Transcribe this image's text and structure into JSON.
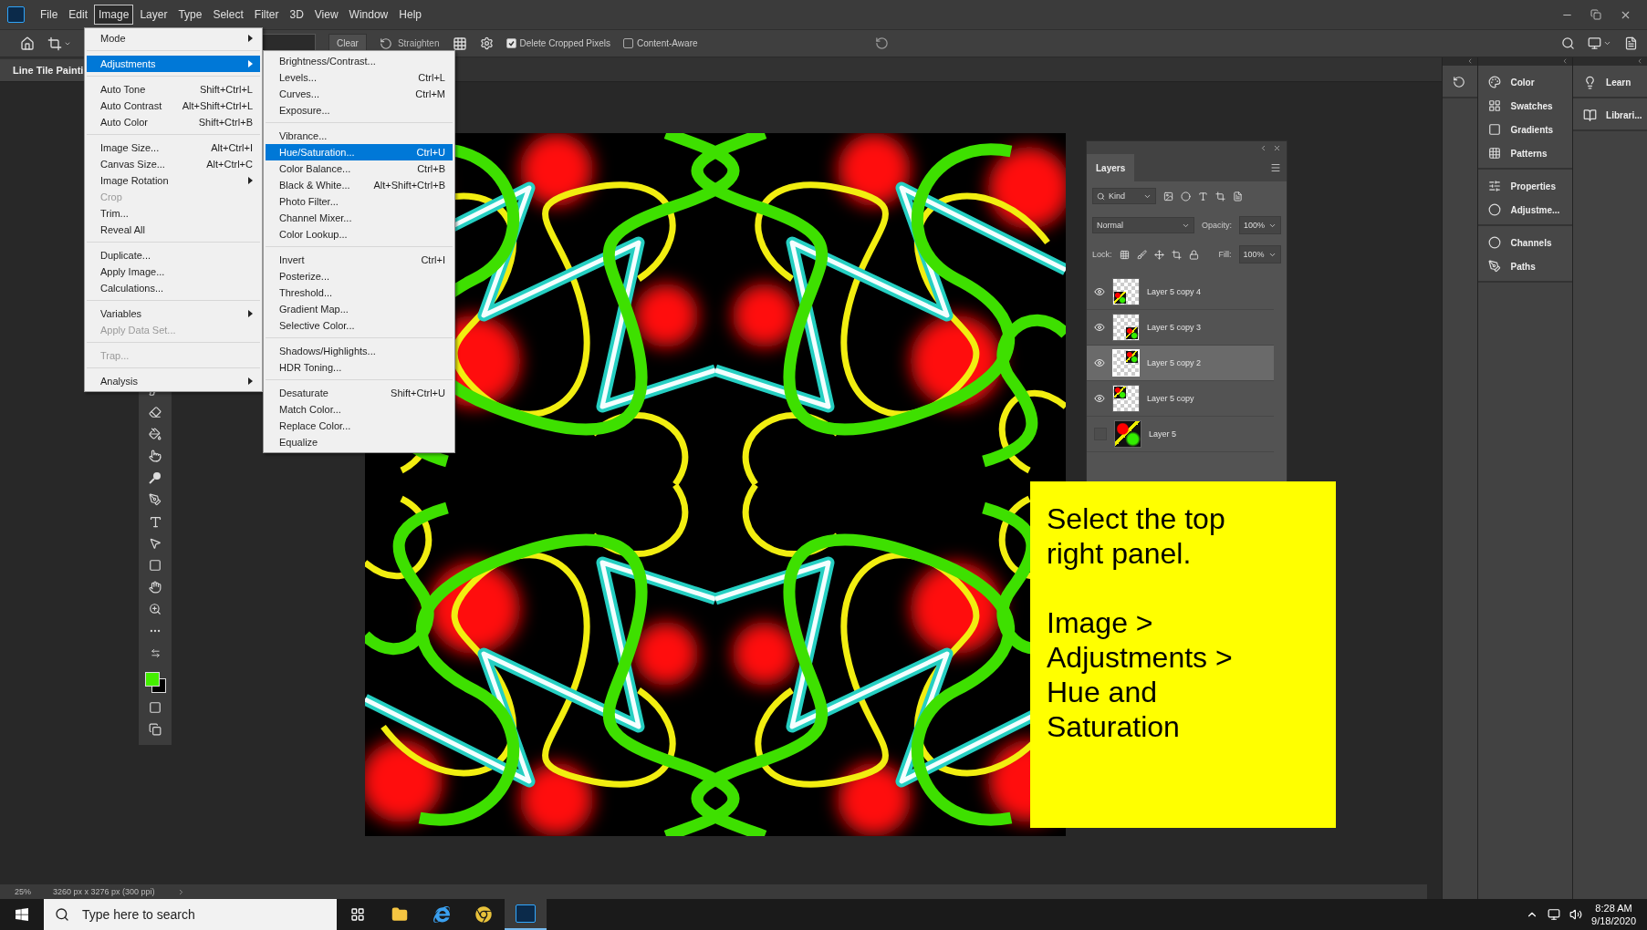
{
  "menu_bar": {
    "items": [
      {
        "label": "File",
        "selected": false
      },
      {
        "label": "Edit",
        "selected": false
      },
      {
        "label": "Image",
        "selected": true
      },
      {
        "label": "Layer",
        "selected": false
      },
      {
        "label": "Type",
        "selected": false
      },
      {
        "label": "Select",
        "selected": false
      },
      {
        "label": "Filter",
        "selected": false
      },
      {
        "label": "3D",
        "selected": false
      },
      {
        "label": "View",
        "selected": false
      },
      {
        "label": "Window",
        "selected": false
      },
      {
        "label": "Help",
        "selected": false
      }
    ]
  },
  "options_bar": {
    "clear_button": "Clear",
    "straighten_button": "Straighten",
    "delete_cropped_pixels": {
      "label": "Delete Cropped Pixels",
      "checked": true
    },
    "content_aware": {
      "label": "Content-Aware",
      "checked": false
    }
  },
  "document_tab": {
    "title": "Line Tile Painti"
  },
  "image_menu": {
    "groups": [
      [
        {
          "label": "Mode",
          "submenu": true,
          "disabled": false,
          "selected": false
        }
      ],
      [
        {
          "label": "Adjustments",
          "submenu": true,
          "disabled": false,
          "selected": true
        }
      ],
      [
        {
          "label": "Auto Tone",
          "shortcut": "Shift+Ctrl+L",
          "submenu": false,
          "disabled": false,
          "selected": false
        },
        {
          "label": "Auto Contrast",
          "shortcut": "Alt+Shift+Ctrl+L",
          "submenu": false,
          "disabled": false,
          "selected": false
        },
        {
          "label": "Auto Color",
          "shortcut": "Shift+Ctrl+B",
          "submenu": false,
          "disabled": false,
          "selected": false
        }
      ],
      [
        {
          "label": "Image Size...",
          "shortcut": "Alt+Ctrl+I",
          "submenu": false,
          "disabled": false,
          "selected": false
        },
        {
          "label": "Canvas Size...",
          "shortcut": "Alt+Ctrl+C",
          "submenu": false,
          "disabled": false,
          "selected": false
        },
        {
          "label": "Image Rotation",
          "submenu": true,
          "disabled": false,
          "selected": false
        },
        {
          "label": "Crop",
          "submenu": false,
          "disabled": true,
          "selected": false
        },
        {
          "label": "Trim...",
          "submenu": false,
          "disabled": false,
          "selected": false
        },
        {
          "label": "Reveal All",
          "submenu": false,
          "disabled": false,
          "selected": false
        }
      ],
      [
        {
          "label": "Duplicate...",
          "submenu": false,
          "disabled": false,
          "selected": false
        },
        {
          "label": "Apply Image...",
          "submenu": false,
          "disabled": false,
          "selected": false
        },
        {
          "label": "Calculations...",
          "submenu": false,
          "disabled": false,
          "selected": false
        }
      ],
      [
        {
          "label": "Variables",
          "submenu": true,
          "disabled": false,
          "selected": false
        },
        {
          "label": "Apply Data Set...",
          "submenu": false,
          "disabled": true,
          "selected": false
        }
      ],
      [
        {
          "label": "Trap...",
          "submenu": false,
          "disabled": true,
          "selected": false
        }
      ],
      [
        {
          "label": "Analysis",
          "submenu": true,
          "disabled": false,
          "selected": false
        }
      ]
    ]
  },
  "adjustments_menu": {
    "groups": [
      [
        {
          "label": "Brightness/Contrast...",
          "selected": false
        },
        {
          "label": "Levels...",
          "shortcut": "Ctrl+L",
          "selected": false
        },
        {
          "label": "Curves...",
          "shortcut": "Ctrl+M",
          "selected": false
        },
        {
          "label": "Exposure...",
          "selected": false
        }
      ],
      [
        {
          "label": "Vibrance...",
          "selected": false
        },
        {
          "label": "Hue/Saturation...",
          "shortcut": "Ctrl+U",
          "selected": true
        },
        {
          "label": "Color Balance...",
          "shortcut": "Ctrl+B",
          "selected": false
        },
        {
          "label": "Black & White...",
          "shortcut": "Alt+Shift+Ctrl+B",
          "selected": false
        },
        {
          "label": "Photo Filter...",
          "selected": false
        },
        {
          "label": "Channel Mixer...",
          "selected": false
        },
        {
          "label": "Color Lookup...",
          "selected": false
        }
      ],
      [
        {
          "label": "Invert",
          "shortcut": "Ctrl+I",
          "selected": false
        },
        {
          "label": "Posterize...",
          "selected": false
        },
        {
          "label": "Threshold...",
          "selected": false
        },
        {
          "label": "Gradient Map...",
          "selected": false
        },
        {
          "label": "Selective Color...",
          "selected": false
        }
      ],
      [
        {
          "label": "Shadows/Highlights...",
          "selected": false
        },
        {
          "label": "HDR Toning...",
          "selected": false
        }
      ],
      [
        {
          "label": "Desaturate",
          "shortcut": "Shift+Ctrl+U",
          "selected": false
        },
        {
          "label": "Match Color...",
          "selected": false
        },
        {
          "label": "Replace Color...",
          "selected": false
        },
        {
          "label": "Equalize",
          "selected": false
        }
      ]
    ]
  },
  "layers_panel": {
    "title": "Layers",
    "filter": "Kind",
    "blend_mode": "Normal",
    "opacity_label": "Opacity:",
    "opacity": "100%",
    "lock_label": "Lock:",
    "fill_label": "Fill:",
    "fill": "100%",
    "layers": [
      {
        "name": "Layer 5 copy 4",
        "visible": true,
        "selected": false
      },
      {
        "name": "Layer 5 copy 3",
        "visible": true,
        "selected": false
      },
      {
        "name": "Layer 5 copy 2",
        "visible": true,
        "selected": true
      },
      {
        "name": "Layer 5 copy",
        "visible": true,
        "selected": false
      },
      {
        "name": "Layer 5",
        "visible": false,
        "selected": false
      }
    ]
  },
  "instruction_note": {
    "paragraphs": [
      "Select the top right panel.",
      "Image > Adjustments > Hue and Saturation"
    ]
  },
  "dock": {
    "column_2": [
      [
        {
          "label": "Color"
        },
        {
          "label": "Swatches"
        },
        {
          "label": "Gradients"
        },
        {
          "label": "Patterns"
        }
      ],
      [
        {
          "label": "Properties"
        },
        {
          "label": "Adjustme..."
        }
      ],
      [
        {
          "label": "Channels"
        },
        {
          "label": "Paths"
        }
      ]
    ],
    "column_3": [
      [
        {
          "label": "Learn"
        }
      ],
      [
        {
          "label": "Librari..."
        }
      ]
    ]
  },
  "status_bar": {
    "zoom": "25%",
    "document_info": "3260 px x 3276 px (300 ppi)"
  },
  "taskbar": {
    "search_placeholder": "Type here to search",
    "time": "8:28 AM",
    "date": "9/18/2020"
  }
}
